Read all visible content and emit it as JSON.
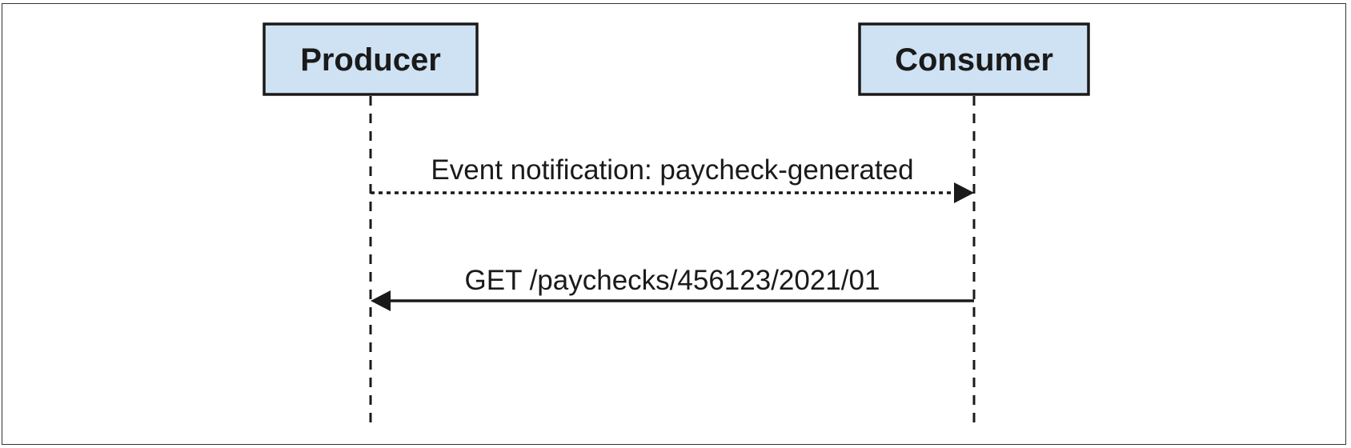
{
  "participants": {
    "producer": {
      "label": "Producer"
    },
    "consumer": {
      "label": "Consumer"
    }
  },
  "messages": [
    {
      "label": "Event notification: paycheck-generated",
      "style": "dotted",
      "from": "producer",
      "to": "consumer"
    },
    {
      "label": "GET /paychecks/456123/2021/01",
      "style": "solid",
      "from": "consumer",
      "to": "producer"
    }
  ],
  "colors": {
    "participant_fill": "#cfe2f3",
    "stroke": "#1a1a1a"
  }
}
